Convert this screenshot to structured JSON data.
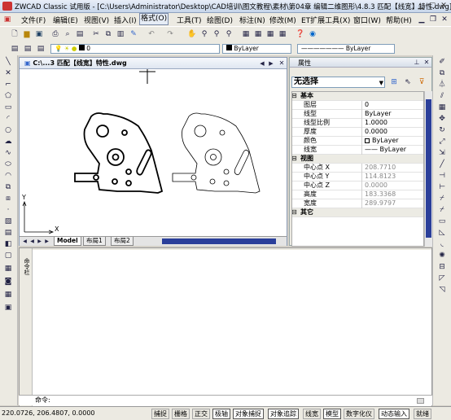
{
  "app": {
    "title": "ZWCAD Classic 试用版 - [C:\\Users\\Administrator\\Desktop\\CAD培训\\图文教程\\素材\\第04章 编辑二维图形\\4.8.3 匹配【线宽】特性.dwg]"
  },
  "menu": [
    "文件(F)",
    "编辑(E)",
    "视图(V)",
    "插入(I)",
    "格式(O)",
    "工具(T)",
    "绘图(D)",
    "标注(N)",
    "修改(M)",
    "ET扩展工具(X)",
    "窗口(W)",
    "帮助(H)"
  ],
  "menu_active_index": 4,
  "toolbar2": {
    "layer_value": "0",
    "color_value": "ByLayer",
    "linetype_value": "ByLayer"
  },
  "drawing": {
    "tab_title": "C:\\...3 匹配【线宽】特性.dwg",
    "axis_x": "X",
    "axis_y": "Y",
    "layout_tabs": [
      "Model",
      "布局1",
      "布局2"
    ]
  },
  "properties": {
    "header": "属性",
    "selection": "无选择",
    "rows": [
      {
        "cat": "基本"
      },
      {
        "k": "图层",
        "v": "0"
      },
      {
        "k": "线型",
        "v": "ByLayer"
      },
      {
        "k": "线型比例",
        "v": "1.0000"
      },
      {
        "k": "厚度",
        "v": "0.0000"
      },
      {
        "k": "颜色",
        "v": "ByLayer"
      },
      {
        "k": "线宽",
        "v": "—— ByLayer"
      },
      {
        "cat": "视图"
      },
      {
        "k": "中心点 X",
        "v": "208.7710",
        "gray": true
      },
      {
        "k": "中心点 Y",
        "v": "114.8123",
        "gray": true
      },
      {
        "k": "中心点 Z",
        "v": "0.0000",
        "gray": true
      },
      {
        "k": "高度",
        "v": "183.3368",
        "gray": true
      },
      {
        "k": "宽度",
        "v": "289.9797",
        "gray": true
      },
      {
        "cat": "其它"
      }
    ]
  },
  "cmd": {
    "side_label": "命令栏",
    "prompt": "命令:"
  },
  "status": {
    "coords": "220.0726,  206.4807,  0.0000",
    "buttons": [
      {
        "label": "捕捉",
        "on": false
      },
      {
        "label": "栅格",
        "on": false
      },
      {
        "label": "正交",
        "on": false
      },
      {
        "label": "极轴",
        "on": true
      },
      {
        "label": "对象捕捉",
        "on": true
      },
      {
        "label": "对象追踪",
        "on": true
      },
      {
        "label": "线宽",
        "on": false
      },
      {
        "label": "模型",
        "on": true
      },
      {
        "label": "数字化仪",
        "on": false
      },
      {
        "label": "动态输入",
        "on": true
      },
      {
        "label": "就绪",
        "on": false
      }
    ]
  }
}
